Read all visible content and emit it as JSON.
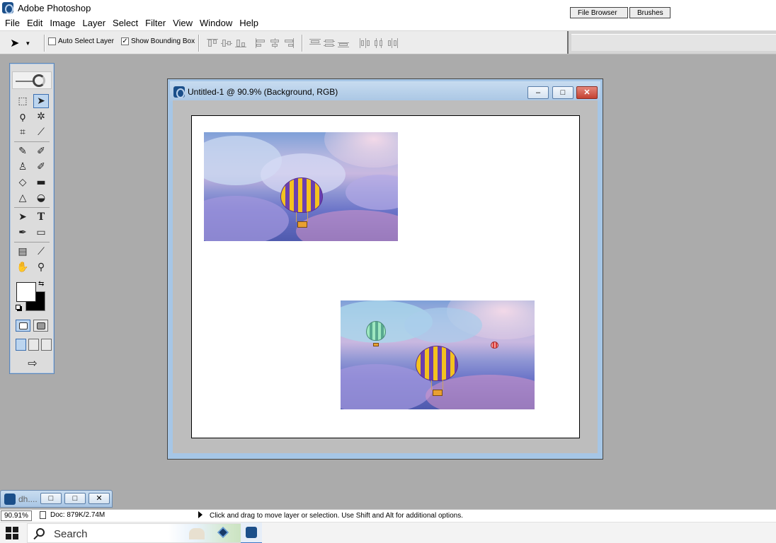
{
  "window": {
    "title": "Adobe Photoshop",
    "icon": "photoshop-icon"
  },
  "menu": [
    "File",
    "Edit",
    "Image",
    "Layer",
    "Select",
    "Filter",
    "View",
    "Window",
    "Help"
  ],
  "options": {
    "auto_select_layer": {
      "label": "Auto Select Layer",
      "checked": false
    },
    "show_bounding_box": {
      "label": "Show Bounding Box",
      "checked": true,
      "mark": "✓"
    }
  },
  "palette_well": {
    "tabs": [
      "File Browser",
      "Brushes"
    ]
  },
  "toolbox": {
    "glyphs": {
      "marquee": "⬚",
      "move": "➤",
      "lasso": "ϙ",
      "magic_wand": "✲",
      "crop": "⌗",
      "slice": "⟋",
      "healing": "✎",
      "brush": "✐",
      "stamp": "♙",
      "history_brush": "✐",
      "eraser": "◇",
      "gradient": "▬",
      "blur": "△",
      "dodge": "◒",
      "path_select": "➤",
      "type": "T",
      "pen": "✒",
      "shape": "▭",
      "notes": "▤",
      "eyedropper": "⟋",
      "hand": "✋",
      "zoom": "⚲",
      "swap": "⇆",
      "jump": "⇨"
    },
    "foreground_color": "#ffffff",
    "background_color": "#000000"
  },
  "document": {
    "title": "Untitled-1 @ 90.9% (Background, RGB)",
    "buttons": {
      "minimize": "–",
      "maximize": "□",
      "close": "✕"
    },
    "canvas_color": "#ffffff"
  },
  "minimized_doc": {
    "title": "dh...."
  },
  "status": {
    "zoom": "90.91%",
    "doc_size": "Doc: 879K/2.74M",
    "message": "Click and drag to move layer or selection.  Use Shift and Alt for additional options."
  },
  "taskbar": {
    "search_placeholder": "Search",
    "apps": [
      "virtualbox-icon",
      "photoshop-icon"
    ]
  }
}
